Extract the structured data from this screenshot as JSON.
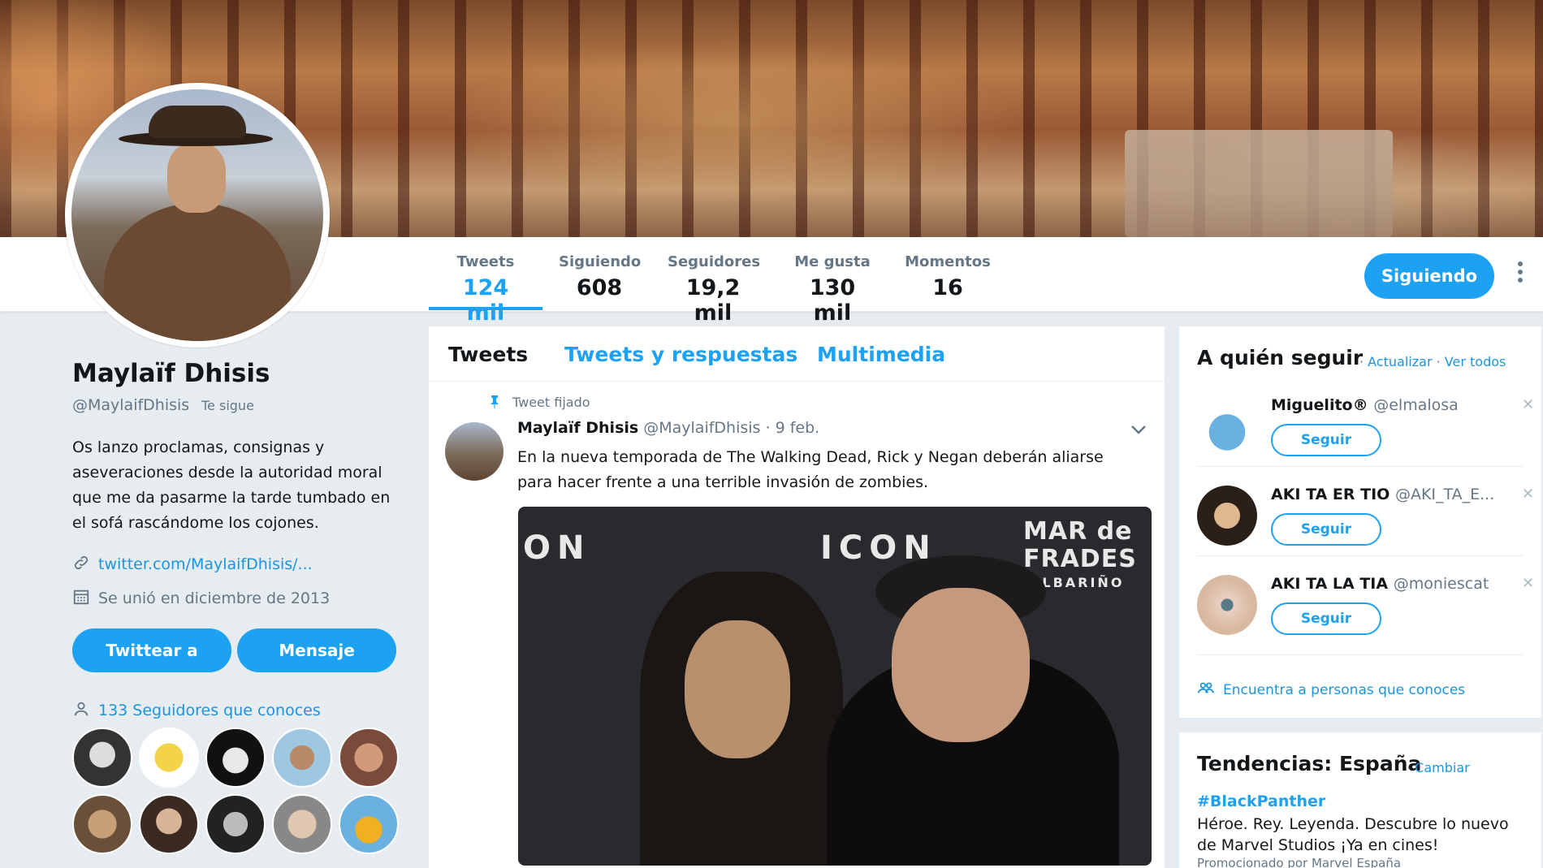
{
  "profile": {
    "name": "Maylaïf Dhisis",
    "handle": "@MaylaifDhisis",
    "follows_you": "Te sigue",
    "bio": "Os lanzo proclamas, consignas y aseveraciones desde la autoridad moral que me da pasarme la tarde tumbado en el sofá rascándome los cojones.",
    "link": "twitter.com/MaylaifDhisis/...",
    "joined": "Se unió en diciembre de 2013",
    "tweet_to_label": "Twittear a",
    "message_label": "Mensaje",
    "followers_you_know": "133 Seguidores que conoces"
  },
  "stats": [
    {
      "label": "Tweets",
      "value": "124 mil"
    },
    {
      "label": "Siguiendo",
      "value": "608"
    },
    {
      "label": "Seguidores",
      "value": "19,2 mil"
    },
    {
      "label": "Me gusta",
      "value": "130 mil"
    },
    {
      "label": "Momentos",
      "value": "16"
    }
  ],
  "following_button": "Siguiendo",
  "timeline": {
    "tabs": [
      "Tweets",
      "Tweets y respuestas",
      "Multimedia"
    ],
    "pinned_label": "Tweet fijado",
    "tweet": {
      "name": "Maylaïf Dhisis",
      "meta": "@MaylaifDhisis · 9 feb.",
      "text": "En la nueva temporada de The Walking Dead, Rick y Negan deberán aliarse para hacer frente a una terrible invasión de zombies.",
      "media_text": [
        "ON",
        "ICON",
        "MAR de FRADES",
        "ALBARIÑO"
      ]
    }
  },
  "who_to_follow": {
    "title": "A quién seguir",
    "refresh": "Actualizar",
    "view_all": "Ver todos",
    "suggestions": [
      {
        "name": "Miguelito®",
        "handle": "@elmalosa",
        "button": "Seguir"
      },
      {
        "name": "AKI TA ER TIO",
        "handle": "@AKI_TA_E...",
        "button": "Seguir"
      },
      {
        "name": "AKI TA LA TIA",
        "handle": "@moniescat",
        "button": "Seguir"
      }
    ],
    "find_people": "Encuentra a personas que conoces"
  },
  "trends": {
    "title": "Tendencias: España",
    "change": "Cambiar",
    "tag": "#BlackPanther",
    "description": "Héroe. Rey. Leyenda. Descubre lo nuevo de Marvel Studios ¡Ya en cines!",
    "promoted": "Promocionado por Marvel España"
  },
  "colors": {
    "accent": "#1da1f2",
    "link": "#1b95e0",
    "muted": "#657786",
    "background": "#e6ecf0"
  }
}
